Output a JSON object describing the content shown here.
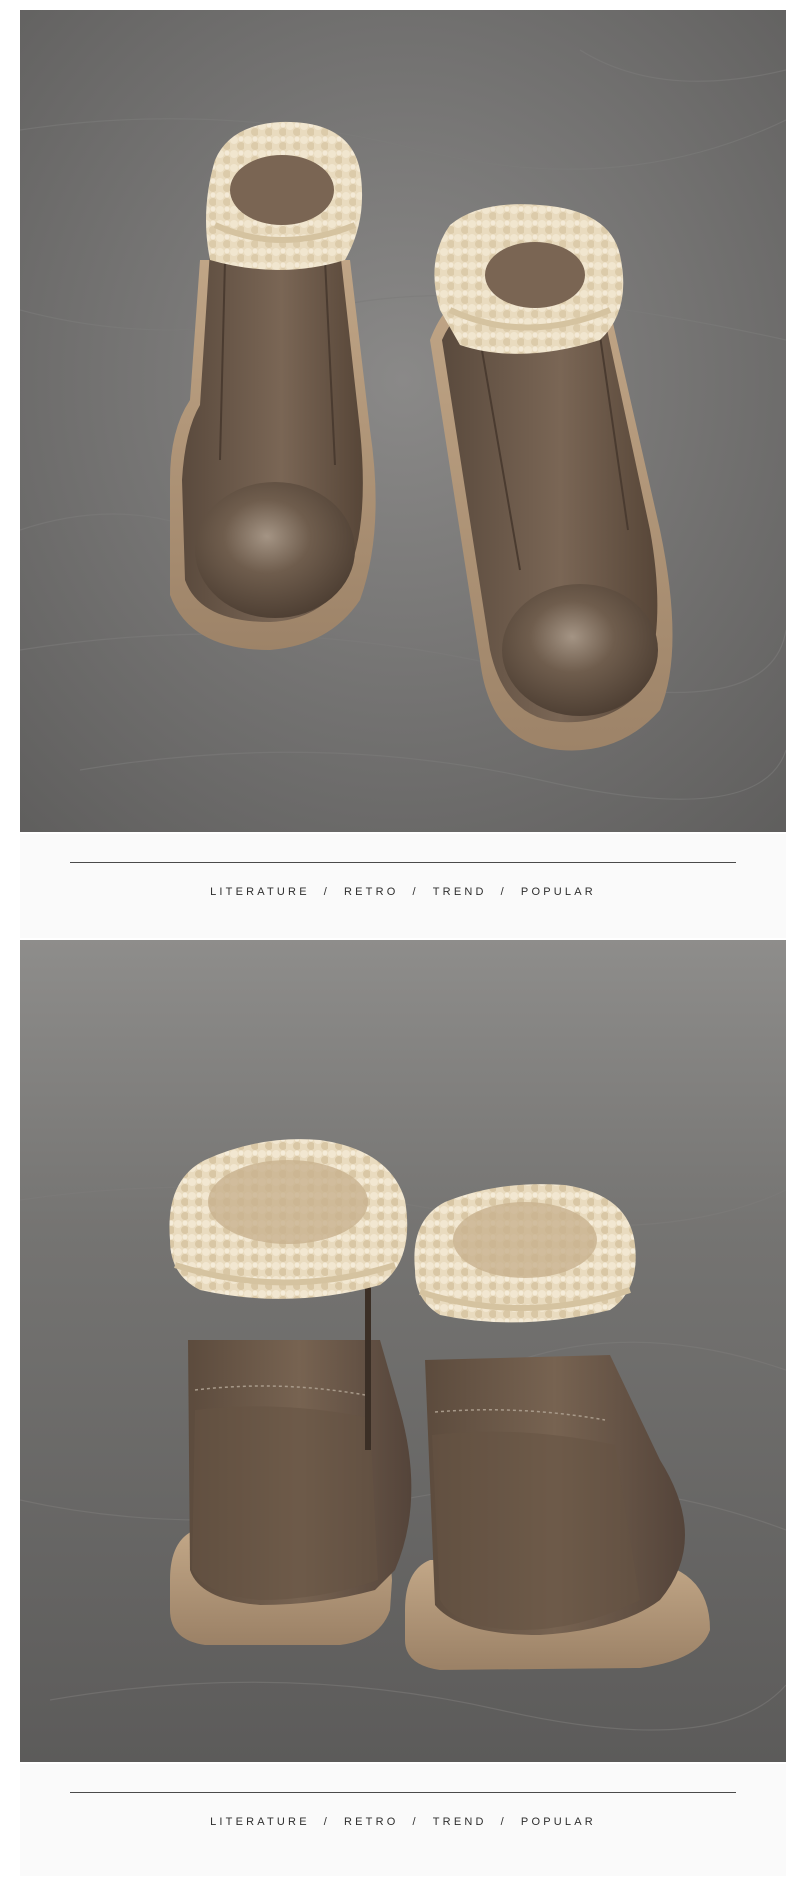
{
  "photos": [
    {
      "subject": "front view of brown fleece-lined ankle boots"
    },
    {
      "subject": "rear view of brown fleece-lined ankle boots"
    }
  ],
  "tagline": {
    "words": [
      "LITERATURE",
      "RETRO",
      "TREND",
      "POPULAR"
    ],
    "separator": "/"
  },
  "colors": {
    "backdrop": "#6e6d6c",
    "leather": "#6f5c4c",
    "fleece": "#eadcc2",
    "sole": "#b3987a",
    "band": "#fafafa",
    "text": "#2e2e2e"
  }
}
